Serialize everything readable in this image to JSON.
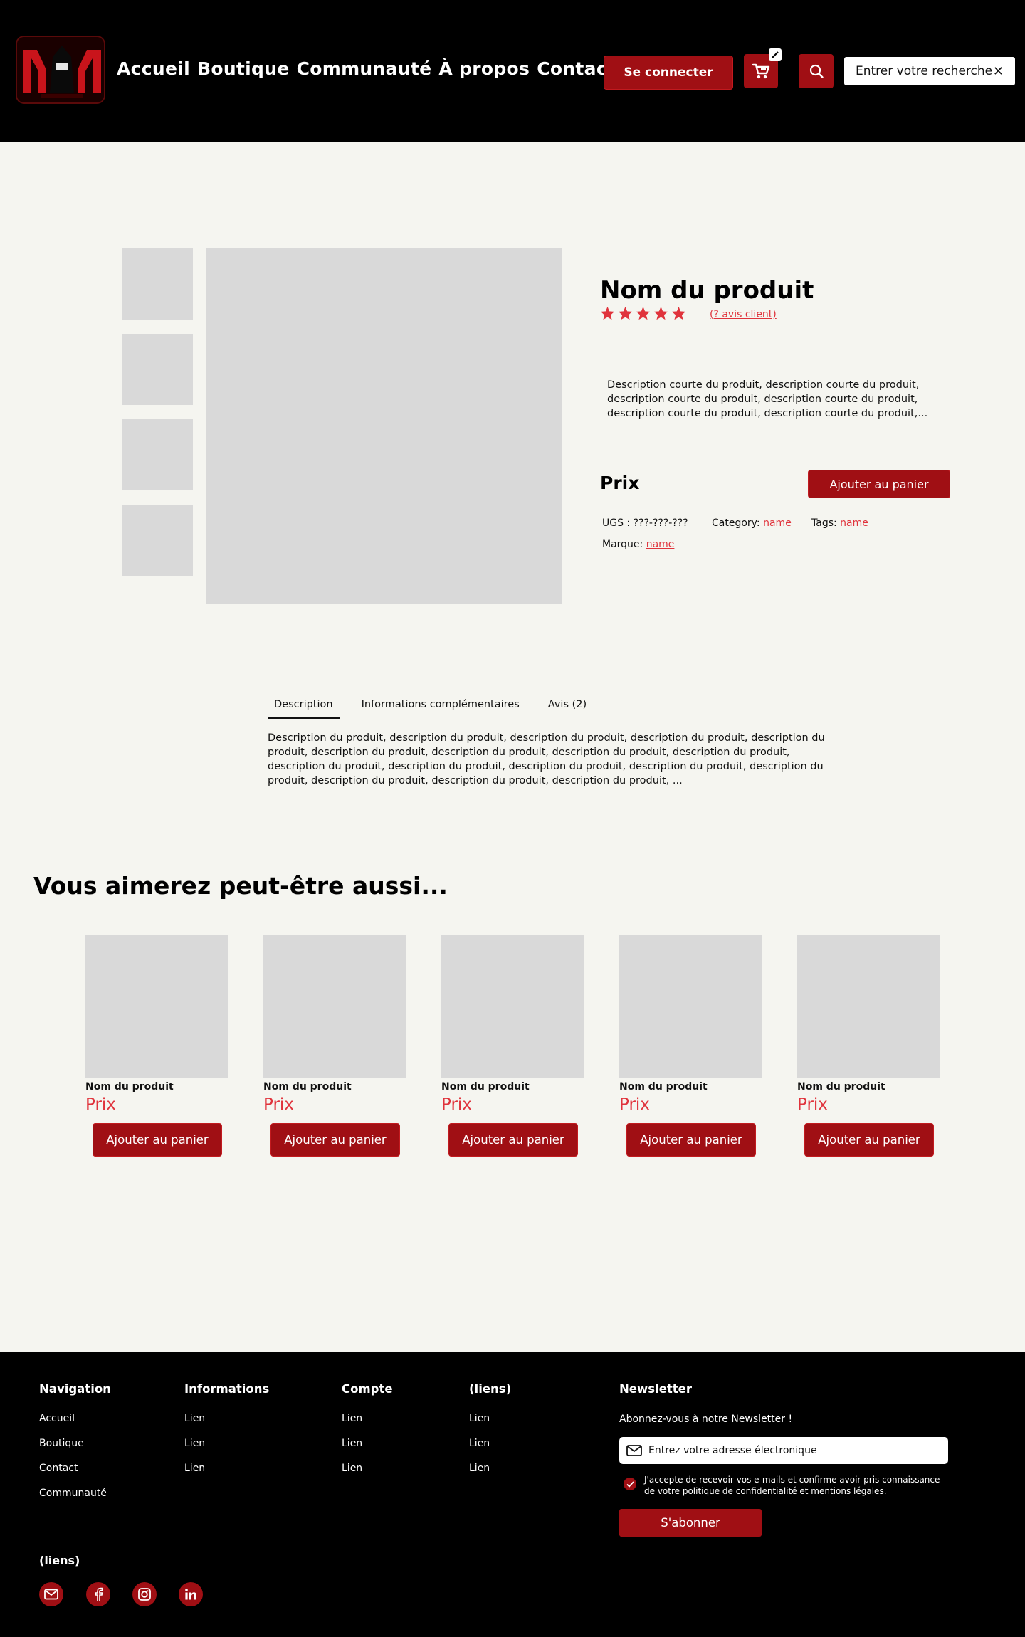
{
  "colors": {
    "accent": "#a00f14",
    "accent_text": "#e0333c",
    "header_bg": "#000000",
    "page_bg": "#f5f5f0",
    "placeholder": "#d9d9d9",
    "star": "#e0333c"
  },
  "header": {
    "logo_icon": "mm-logo",
    "nav": [
      "Accueil",
      "Boutique",
      "Communauté",
      "À propos",
      "Contact"
    ],
    "login_label": "Se connecter",
    "cart_icon": "cart-icon",
    "search_icon": "search-icon",
    "search_placeholder": "Entrer votre recherche",
    "clear_icon": "close-icon"
  },
  "product": {
    "title": "Nom du produit",
    "rating": 5,
    "reviews_link": "(? avis client)",
    "short_description": "Description courte du produit, description courte du produit, description courte du produit, description courte du produit, description courte du produit, description courte du produit,...",
    "price": "Prix",
    "add_to_cart": "Ajouter au panier",
    "sku_label": "UGS : ???-???-???",
    "category_label": "Category:",
    "category_value": "name",
    "tags_label": "Tags:",
    "tags_value": "name",
    "brand_label": "Marque:",
    "brand_value": "name"
  },
  "tabs": {
    "items": [
      "Description",
      "Informations complémentaires",
      "Avis (2)"
    ],
    "active": 0,
    "content": "Description du produit, description du produit, description du produit, description du produit, description du produit, description du produit, description du produit, description du produit, description du produit, description du produit, description du produit, description du produit, description du produit, description du produit, description du produit, description du produit, description du produit, ..."
  },
  "related": {
    "title": "Vous aimerez peut-être aussi...",
    "items": [
      {
        "name": "Nom du produit",
        "price": "Prix",
        "button": "Ajouter au panier"
      },
      {
        "name": "Nom du produit",
        "price": "Prix",
        "button": "Ajouter au panier"
      },
      {
        "name": "Nom du produit",
        "price": "Prix",
        "button": "Ajouter au panier"
      },
      {
        "name": "Nom du produit",
        "price": "Prix",
        "button": "Ajouter au panier"
      },
      {
        "name": "Nom du produit",
        "price": "Prix",
        "button": "Ajouter au panier"
      }
    ]
  },
  "footer": {
    "columns": [
      {
        "title": "Navigation",
        "items": [
          "Accueil",
          "Boutique",
          "Contact",
          "Communauté"
        ]
      },
      {
        "title": "Informations",
        "items": [
          "Lien",
          "Lien",
          "Lien"
        ]
      },
      {
        "title": "Compte",
        "items": [
          "Lien",
          "Lien",
          "Lien"
        ]
      },
      {
        "title": "(liens)",
        "items": [
          "Lien",
          "Lien",
          "Lien"
        ]
      }
    ],
    "newsletter": {
      "title": "Newsletter",
      "subtitle": "Abonnez-vous à notre Newsletter !",
      "email_placeholder": "Entrez votre adresse électronique",
      "consent": "J'accepte de recevoir vos e-mails et confirme avoir pris connaissance de votre politique de confidentialité et mentions légales.",
      "subscribe_label": "S'abonner"
    },
    "social_title": "(liens)",
    "social_icons": [
      "mail-icon",
      "facebook-icon",
      "instagram-icon",
      "linkedin-icon"
    ]
  }
}
